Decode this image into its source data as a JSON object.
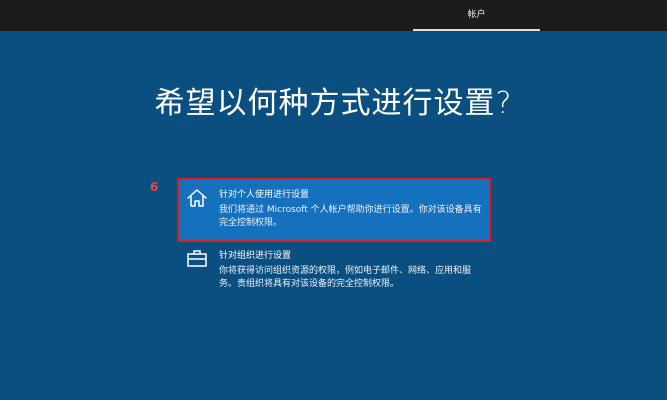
{
  "topbar": {
    "tab_label": "帐户"
  },
  "page": {
    "title": "希望以何种方式进行设置?"
  },
  "annotation": {
    "step_number": "6",
    "color": "#ff3b3b"
  },
  "options": [
    {
      "id": "personal",
      "icon": "home-icon",
      "heading": "针对个人使用进行设置",
      "description": "我们将通过 Microsoft 个人帐户帮助你进行设置。你对该设备具有完全控制权限。",
      "selected": true
    },
    {
      "id": "organization",
      "icon": "briefcase-icon",
      "heading": "针对组织进行设置",
      "description": "你将获得访问组织资源的权限，例如电子邮件、网络、应用和服务。贵组织将具有对该设备的完全控制权限。",
      "selected": false
    }
  ],
  "colors": {
    "background": "#0b4f80",
    "selected_option": "#1570bd",
    "selection_outline": "#d92020",
    "topbar": "#1c1c1c"
  }
}
